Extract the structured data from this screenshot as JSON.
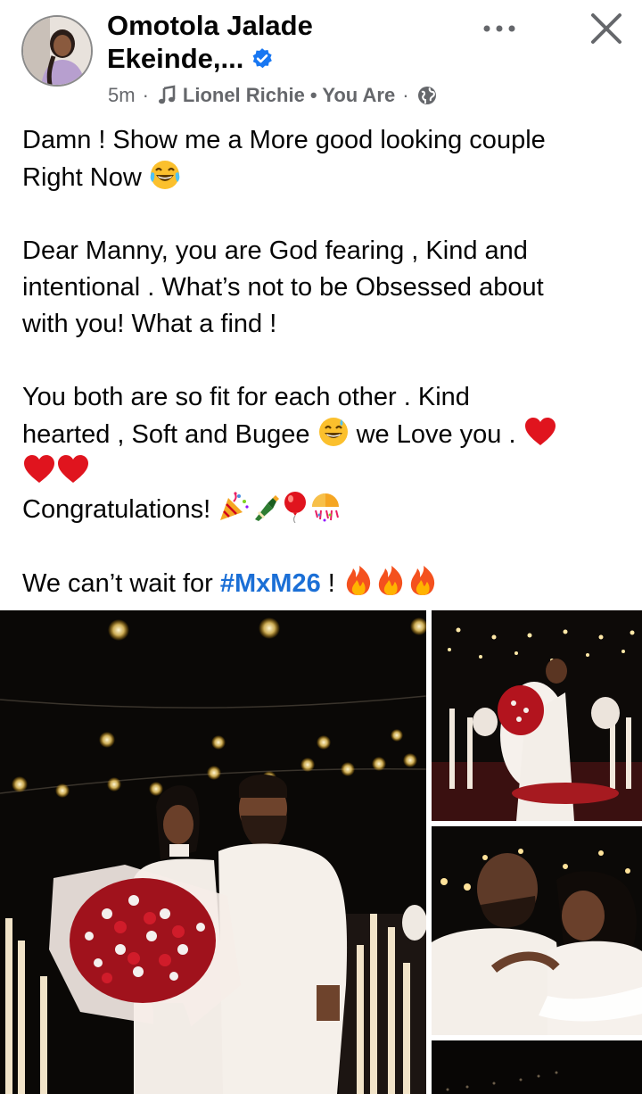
{
  "author": {
    "name_line1": "Omotola Jalade",
    "name_line2": "Ekeinde,..."
  },
  "meta": {
    "time": "5m",
    "song": "Lionel Richie • You Are"
  },
  "post": {
    "p1_line1": "Damn ! Show me a More good looking couple",
    "p1_line2": "Right Now",
    "p2_line1": "Dear Manny, you are God  fearing , Kind and",
    "p2_line2": "intentional . What’s not to be Obsessed about",
    "p2_line3": "with you! What a find !",
    "p3_line1": "You both are so fit for each other . Kind",
    "p3_line2": "hearted , Soft and Bugee",
    "p3_line2b": "we Love you .",
    "p4": "Congratulations!",
    "p5_pre": "We can’t wait for",
    "hashtag": "#MxM26",
    "p5_post": "!"
  },
  "icons": [
    "more-icon",
    "close-icon",
    "verified-badge-icon",
    "music-note-icon",
    "globe-icon"
  ],
  "colors": {
    "hashtag": "#1b6fd6",
    "verified": "#1877f2",
    "meta": "#65676b"
  }
}
